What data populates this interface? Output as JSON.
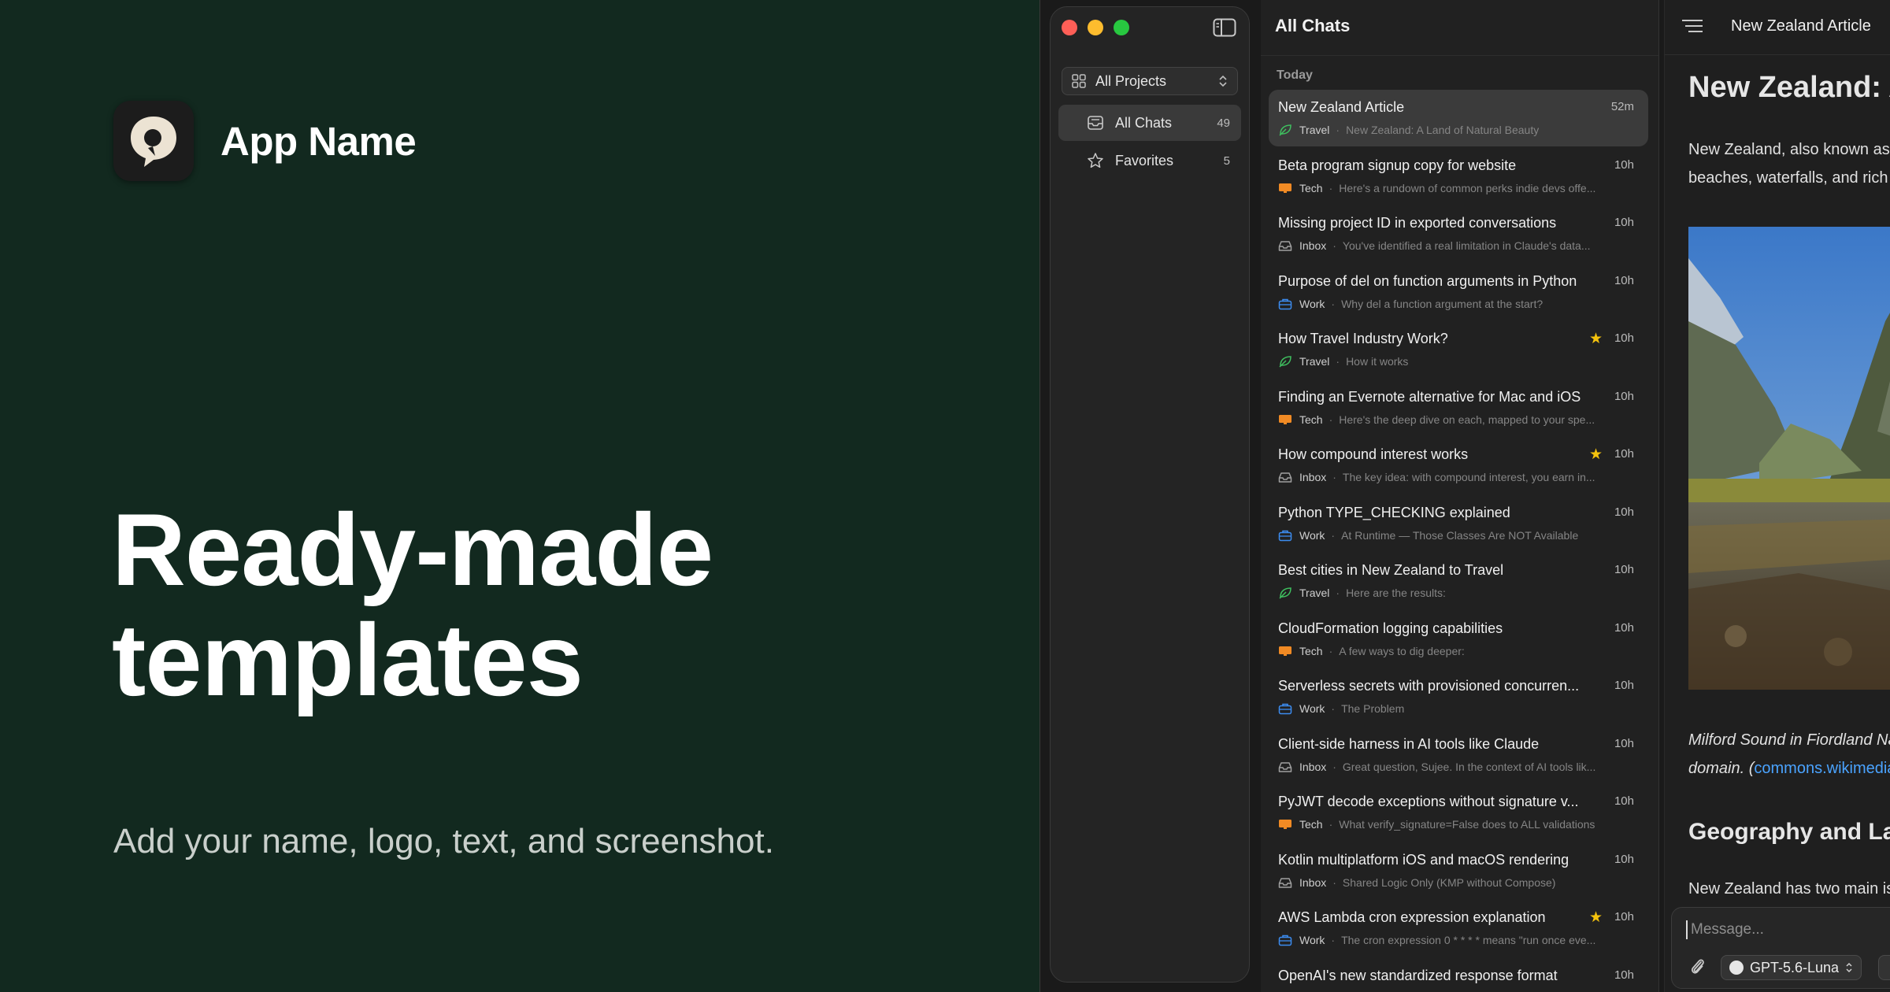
{
  "brand": {
    "app_name": "App Name"
  },
  "hero": {
    "headline_line1": "Ready-made",
    "headline_line2": "templates",
    "subline": "Add your name, logo, text, and screenshot."
  },
  "sidebar": {
    "project_select": "All Projects",
    "nav": [
      {
        "label": "All Chats",
        "count": "49"
      },
      {
        "label": "Favorites",
        "count": "5"
      }
    ]
  },
  "chatlist": {
    "title": "All Chats",
    "section": "Today",
    "rows": [
      {
        "title": "New Zealand Article",
        "time": "52m",
        "star": "",
        "project": "Travel",
        "icon": "leaf-icon",
        "preview": "New Zealand: A Land of Natural Beauty",
        "selected": true
      },
      {
        "title": "Beta program signup copy for website",
        "time": "10h",
        "star": "",
        "project": "Tech",
        "icon": "monitor-icon",
        "preview": "Here's a rundown of common perks indie devs offe...",
        "selected": false
      },
      {
        "title": "Missing project ID in exported conversations",
        "time": "10h",
        "star": "",
        "project": "Inbox",
        "icon": "inbox-icon",
        "preview": "You've identified a real limitation in Claude's data...",
        "selected": false
      },
      {
        "title": "Purpose of del on function arguments in Python",
        "time": "10h",
        "star": "",
        "project": "Work",
        "icon": "briefcase-icon",
        "preview": "Why del a function argument at the start?",
        "selected": false
      },
      {
        "title": "How Travel Industry Work?",
        "time": "10h",
        "star": "★",
        "project": "Travel",
        "icon": "leaf-icon",
        "preview": "How it works",
        "selected": false
      },
      {
        "title": "Finding an Evernote alternative for Mac and iOS",
        "time": "10h",
        "star": "",
        "project": "Tech",
        "icon": "monitor-icon",
        "preview": "Here's the deep dive on each, mapped to your spe...",
        "selected": false
      },
      {
        "title": "How compound interest works",
        "time": "10h",
        "star": "★",
        "project": "Inbox",
        "icon": "inbox-icon",
        "preview": "The key idea: with compound interest, you earn in...",
        "selected": false
      },
      {
        "title": "Python TYPE_CHECKING explained",
        "time": "10h",
        "star": "",
        "project": "Work",
        "icon": "briefcase-icon",
        "preview": "At Runtime — Those Classes Are NOT Available",
        "selected": false
      },
      {
        "title": "Best cities in New Zealand to Travel",
        "time": "10h",
        "star": "",
        "project": "Travel",
        "icon": "leaf-icon",
        "preview": "Here are the results:",
        "selected": false
      },
      {
        "title": "CloudFormation logging capabilities",
        "time": "10h",
        "star": "",
        "project": "Tech",
        "icon": "monitor-icon",
        "preview": "A few ways to dig deeper:",
        "selected": false
      },
      {
        "title": "Serverless secrets with provisioned concurren...",
        "time": "10h",
        "star": "",
        "project": "Work",
        "icon": "briefcase-icon",
        "preview": "The Problem",
        "selected": false
      },
      {
        "title": "Client-side harness in AI tools like Claude",
        "time": "10h",
        "star": "",
        "project": "Inbox",
        "icon": "inbox-icon",
        "preview": "Great question, Sujee. In the context of AI tools lik...",
        "selected": false
      },
      {
        "title": "PyJWT decode exceptions without signature v...",
        "time": "10h",
        "star": "",
        "project": "Tech",
        "icon": "monitor-icon",
        "preview": "What verify_signature=False does to ALL validations",
        "selected": false
      },
      {
        "title": "Kotlin multiplatform iOS and macOS rendering",
        "time": "10h",
        "star": "",
        "project": "Inbox",
        "icon": "inbox-icon",
        "preview": "Shared Logic Only (KMP without Compose)",
        "selected": false
      },
      {
        "title": "AWS Lambda cron expression explanation",
        "time": "10h",
        "star": "★",
        "project": "Work",
        "icon": "briefcase-icon",
        "preview": "The cron expression 0 * * * * means \"run once eve...",
        "selected": false
      },
      {
        "title": "OpenAI's new standardized response format",
        "time": "10h",
        "star": "",
        "project": "",
        "icon": "",
        "preview": "",
        "selected": false
      }
    ]
  },
  "detail": {
    "header_title": "New Zealand Article",
    "h1": "New Zealand: A Land of Natural Beauty",
    "para_line1": "New Zealand, also known as Aotearoa, is a land of",
    "para_line2": "beaches, waterfalls, and rich culture.",
    "caption_text": "Milford Sound in Fiordland National Park. Public",
    "caption_line2": "domain. (",
    "caption_link": "commons.wikimedia.org",
    "h2": "Geography and Landscape",
    "para2": "New Zealand has two main islands",
    "composer_placeholder": "Message...",
    "model": "GPT-5.6-Luna"
  },
  "colors": {
    "background": "#12291f",
    "accent_star": "#f4c20d",
    "link": "#4aa3ff",
    "travel": "#3fbf5f",
    "tech": "#f08a24",
    "work": "#3c8cf0",
    "inbox": "#a0a0a0"
  }
}
